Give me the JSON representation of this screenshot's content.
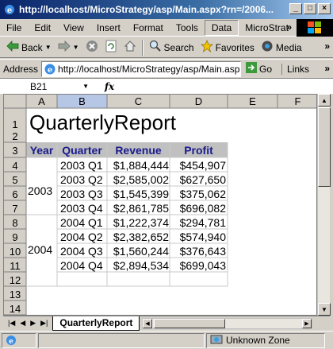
{
  "window": {
    "title": "http://localhost/MicroStrategy/asp/Main.aspx?rn=/2006..."
  },
  "menubar": {
    "items": [
      "File",
      "Edit",
      "View",
      "Insert",
      "Format",
      "Tools",
      "Data",
      "MicroStrat"
    ],
    "active": "Data",
    "overflow": "»"
  },
  "toolbar": {
    "back_label": "Back",
    "search_label": "Search",
    "favorites_label": "Favorites",
    "media_label": "Media",
    "overflow": "»"
  },
  "addressbar": {
    "label": "Address",
    "url": "http://localhost/MicroStrategy/asp/Main.aspx?",
    "go_label": "Go",
    "links_label": "Links",
    "overflow": "»"
  },
  "formulabar": {
    "namebox": "B21",
    "fx_label": "fx",
    "formula": ""
  },
  "sheet": {
    "columns": [
      "A",
      "B",
      "C",
      "D",
      "E",
      "F"
    ],
    "rows": [
      "1",
      "2",
      "3",
      "4",
      "5",
      "6",
      "7",
      "8",
      "9",
      "10",
      "11",
      "12",
      "13",
      "14"
    ],
    "title": "QuarterlyReport",
    "headers": {
      "year": "Year",
      "quarter": "Quarter",
      "revenue": "Revenue",
      "profit": "Profit"
    },
    "groups": [
      {
        "year": "2003",
        "rows": [
          {
            "quarter": "2003 Q1",
            "revenue": "$1,884,444",
            "profit": "$454,907"
          },
          {
            "quarter": "2003 Q2",
            "revenue": "$2,585,002",
            "profit": "$627,650"
          },
          {
            "quarter": "2003 Q3",
            "revenue": "$1,545,399",
            "profit": "$375,062"
          },
          {
            "quarter": "2003 Q4",
            "revenue": "$2,861,785",
            "profit": "$696,082"
          }
        ]
      },
      {
        "year": "2004",
        "rows": [
          {
            "quarter": "2004 Q1",
            "revenue": "$1,222,374",
            "profit": "$294,781"
          },
          {
            "quarter": "2004 Q2",
            "revenue": "$2,382,652",
            "profit": "$574,940"
          },
          {
            "quarter": "2004 Q3",
            "revenue": "$1,560,244",
            "profit": "$376,643"
          },
          {
            "quarter": "2004 Q4",
            "revenue": "$2,894,534",
            "profit": "$699,043"
          }
        ]
      }
    ]
  },
  "tabs": {
    "sheet_tab": "QuarterlyReport"
  },
  "statusbar": {
    "zone": "Unknown Zone"
  },
  "colors": {
    "header_text": "#1a1a8c",
    "header_fill": "#c0c0c0",
    "selected_col": "#b6c7e6"
  }
}
